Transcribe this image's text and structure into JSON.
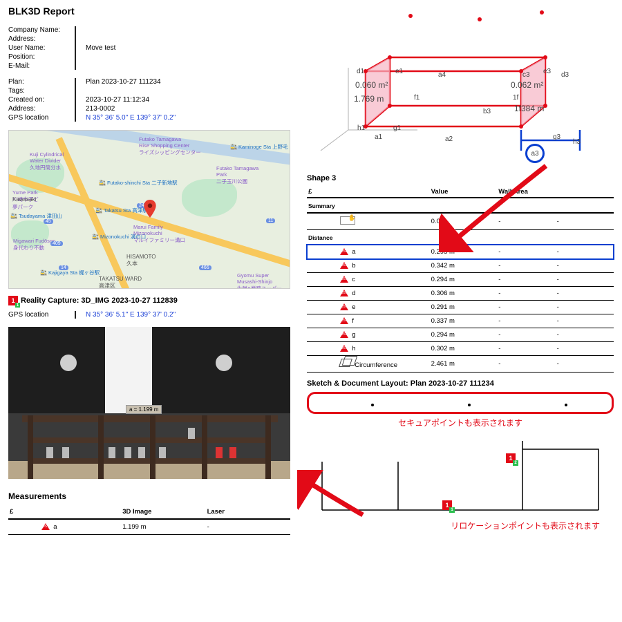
{
  "report_title": "BLK3D Report",
  "company": {
    "label_company": "Company Name:",
    "label_address": "Address:",
    "label_user": "User Name:",
    "label_position": "Position:",
    "label_email": "E-Mail:",
    "user_value": "Move test"
  },
  "plan": {
    "label_plan": "Plan:",
    "label_tags": "Tags:",
    "label_created": "Created on:",
    "label_address": "Address:",
    "label_gps": "GPS location",
    "plan_value": "Plan 2023-10-27 111234",
    "created_value": "2023-10-27 11:12:34",
    "address_value": "213-0002",
    "gps_value": "N 35° 36' 5.0\" E 139° 37' 0.2\""
  },
  "map": {
    "pois": {
      "kuji": "Kuji Cylindrical\nWater Divider\n久地円筒分水",
      "yume": "Yume Park\n川崎市子ど\n夢パーク",
      "migawari": "Migawari Fudōson\n身代わり不動",
      "kajigaya": "Kajigaya Sta\n梶ヶ谷駅",
      "futako_sc": "Futako Tamagawa\nRise Shopping Center\nライズシッピングセンター",
      "futako_park": "Futako Tamagawa\nPark\n二子玉川公園",
      "marui": "Marui Family\nMizonokuchi\nマルイファミリー溝口",
      "hisamoto": "HISAMOTO\n久本",
      "takatsu_ward": "TAKATSU WARD\n高津区",
      "gyomu": "Gyomu Super\nMusashi-Shinjo\n生鮮&業務スーパー",
      "tsudayama": "Tsudayama\n津田山",
      "kaminoge": "Kaminoge Sta\n上野毛",
      "futako_sta": "Futako-shinchi Sta\n二子新地駅",
      "takatsu_sta": "Takatsu Sta\n高津駅",
      "mizo": "Mizonokuchi\n溝の口",
      "kawasaki": "Kawasaki"
    },
    "roads": {
      "r246": "246",
      "r409": "409",
      "r466": "466",
      "r14": "14",
      "r45": "45",
      "r11": "11"
    }
  },
  "rc": {
    "title": "Reality Capture: 3D_IMG 2023-10-27 112839",
    "gps_label": "GPS location",
    "gps_value": "N 35° 36' 5.1\" E 139° 37' 0.2\"",
    "measure_badge": "a = 1.199 m"
  },
  "measurements": {
    "title": "Measurements",
    "col1": "£",
    "col2": "3D Image",
    "col3": "Laser",
    "row_a_name": "a",
    "row_a_val": "1.199 m",
    "row_a_laser": "-"
  },
  "d3": {
    "lbls": {
      "d1": "d1",
      "e1": "e1",
      "a4": "a4",
      "c3": "c3",
      "e3": "e3",
      "d3": "d3",
      "area1": "0.060 m²",
      "area2": "0.062 m²",
      "len1": "1.769 m",
      "f1": "f1",
      "b3": "b3",
      "len2": "1f384 m",
      "1f": "1f",
      "h1": "h1",
      "a1": "a1",
      "g1": "g1",
      "a2": "a2",
      "a3": "a3",
      "g3": "g3",
      "h3": "h3"
    }
  },
  "shape": {
    "title": "Shape 3",
    "col1": "£",
    "col2": "Value",
    "col3": "Wall Area",
    "sec_summary": "Summary",
    "sec_distance": "Distance",
    "summary_val": "0.0",
    "rows": [
      {
        "n": "a",
        "v": "0.295 m"
      },
      {
        "n": "b",
        "v": "0.342 m"
      },
      {
        "n": "c",
        "v": "0.294 m"
      },
      {
        "n": "d",
        "v": "0.306 m"
      },
      {
        "n": "e",
        "v": "0.291 m"
      },
      {
        "n": "f",
        "v": "0.337 m"
      },
      {
        "n": "g",
        "v": "0.294 m"
      },
      {
        "n": "h",
        "v": "0.302 m"
      }
    ],
    "circ_label": "Circumference",
    "circ_val": "2.461 m"
  },
  "sketch": {
    "title": "Sketch & Document Layout: Plan 2023-10-27 111234",
    "anno1": "セキュアポイントも表示されます",
    "anno2": "リロケーションポイントも表示されます"
  }
}
